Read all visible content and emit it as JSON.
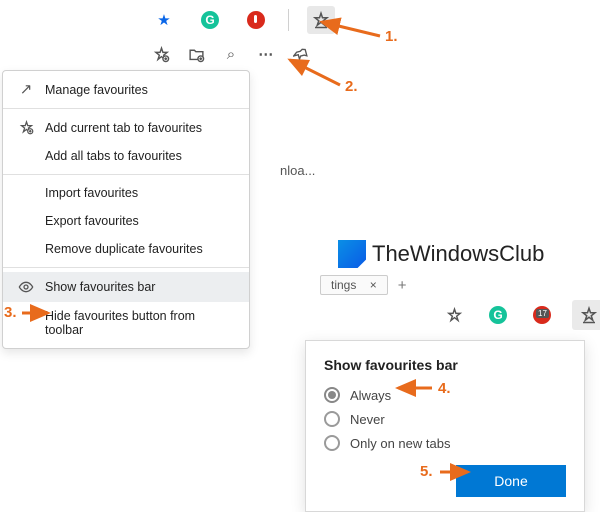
{
  "toolbar": {
    "favourites_star": "★",
    "grammarly_letter": "G",
    "favourites_menu_glyph": "✩"
  },
  "fav_header": {
    "add_glyph": "✩",
    "collections_glyph": "⧉",
    "search_glyph": "⌕",
    "more_glyph": "⋯",
    "pin_glyph": "📌"
  },
  "menu": {
    "manage": "Manage favourites",
    "add_current": "Add current tab to favourites",
    "add_all": "Add all tabs to favourites",
    "import": "Import favourites",
    "export": "Export favourites",
    "remove_dup": "Remove duplicate favourites",
    "show_bar": "Show favourites bar",
    "hide_button": "Hide favourites button from toolbar",
    "open_glyph": "↗",
    "star_add_glyph": "✩",
    "eye_glyph": "👁"
  },
  "background": {
    "truncated": "nloa...",
    "brand": "TheWindowsClub",
    "tab_label": "tings",
    "tab_close": "×",
    "tab_new": "+",
    "badge_count": "17"
  },
  "popup": {
    "title": "Show favourites bar",
    "options": [
      "Always",
      "Never",
      "Only on new tabs"
    ],
    "selected_index": 0,
    "done_label": "Done"
  },
  "annotations": {
    "a1": "1.",
    "a2": "2.",
    "a3": "3.",
    "a4": "4.",
    "a5": "5."
  }
}
